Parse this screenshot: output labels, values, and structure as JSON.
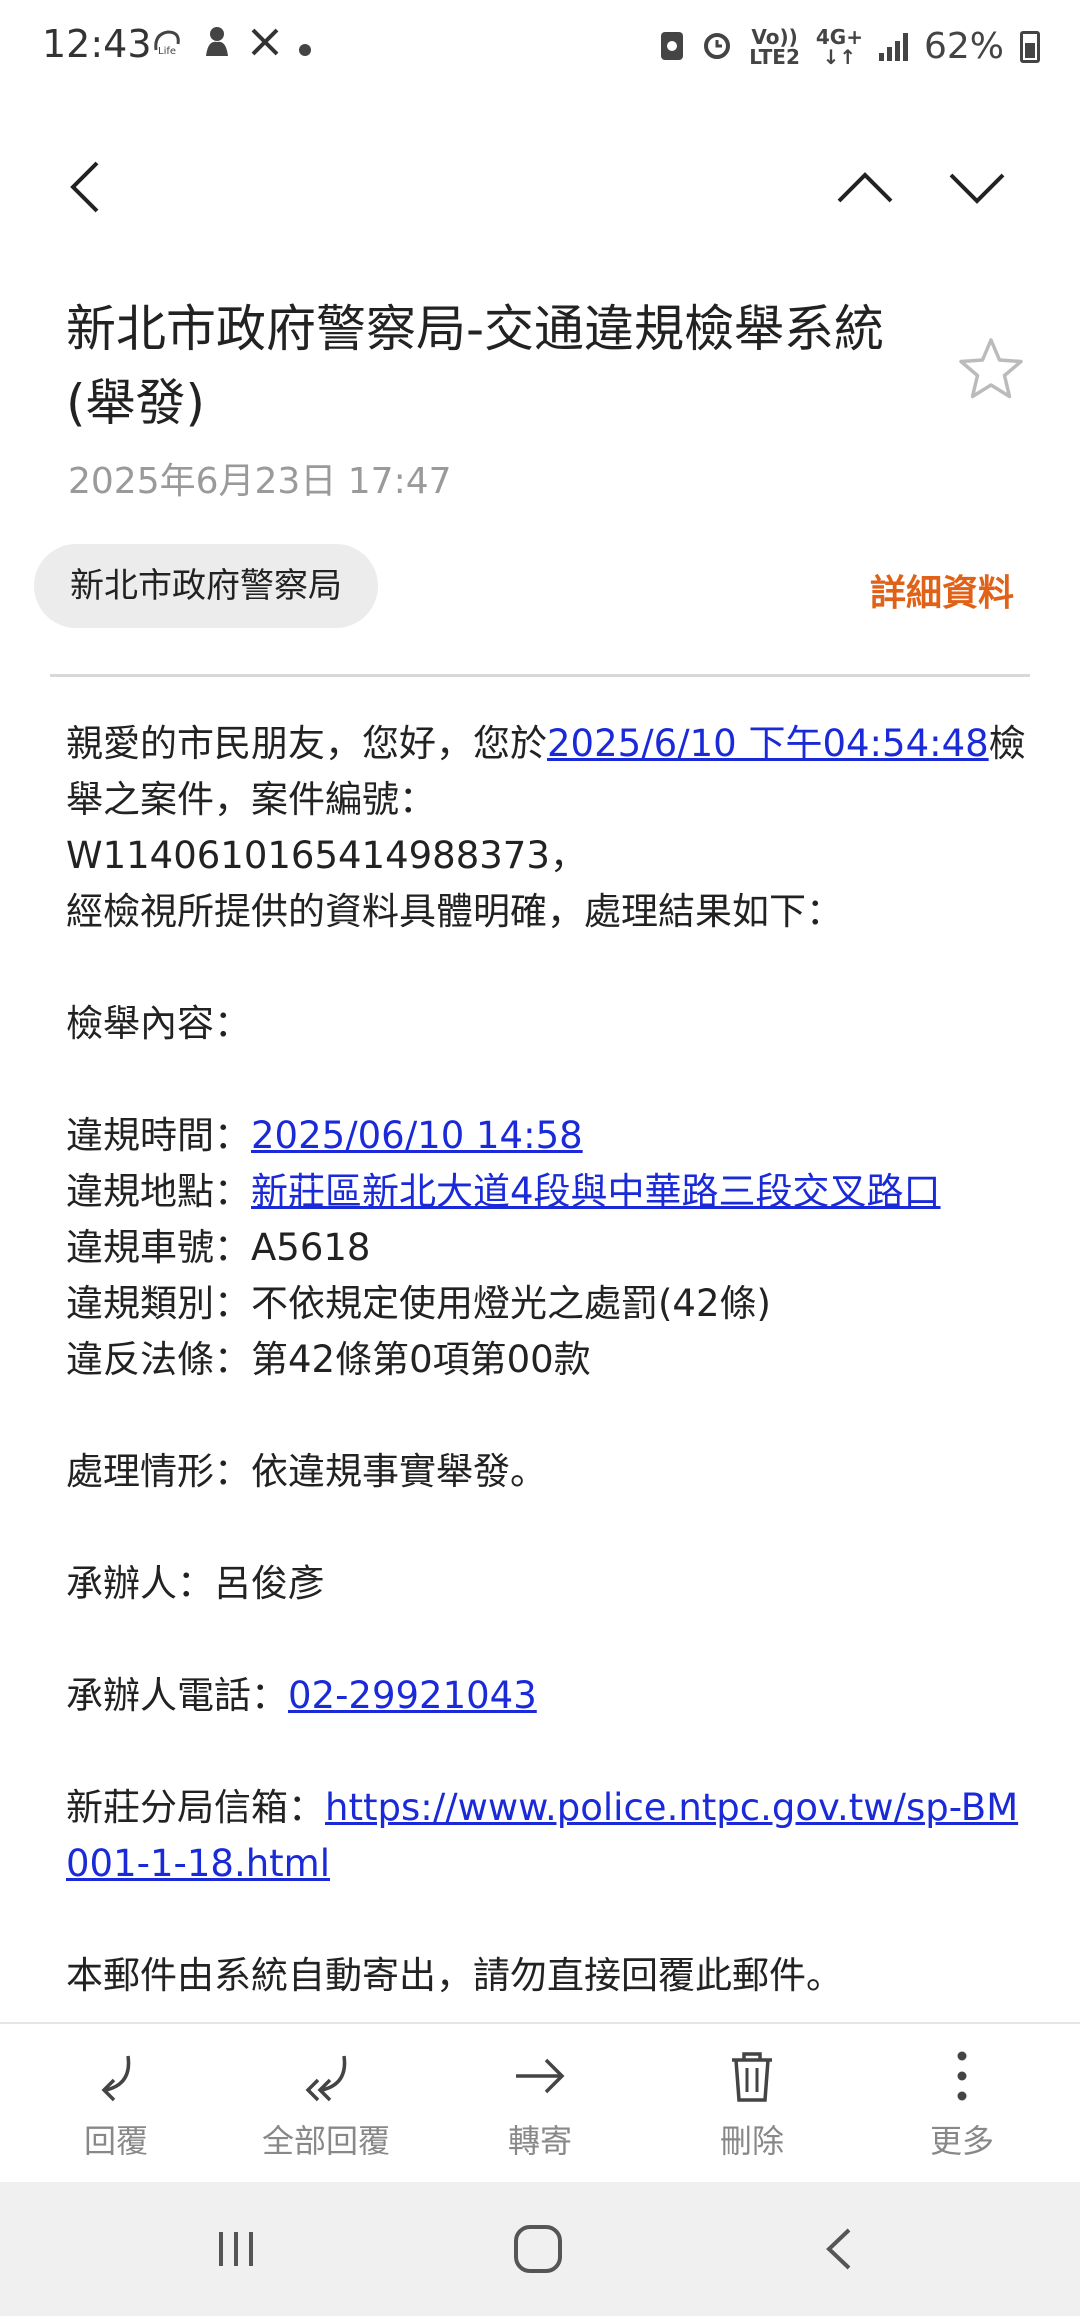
{
  "status_bar": {
    "time": "12:43",
    "left_icons": [
      "lte-app-icon",
      "notification-icon",
      "x-app-icon",
      "dot-icon"
    ],
    "network_top": "Vo))",
    "network_bottom": "LTE2",
    "network_type": "4G+",
    "battery": "62%"
  },
  "header": {
    "subject": "新北市政府警察局-交通違規檢舉系統(舉發)",
    "date": "2025年6月23日  17:47",
    "sender": "新北市政府警察局",
    "details_label": "詳細資料"
  },
  "body": {
    "intro_prefix": "親愛的市民朋友，您好，您於",
    "intro_link": "2025/6/10 下午04:54:48",
    "intro_suffix": "檢舉之案件，案件編號：",
    "case_number": "W1140610165414988373，",
    "review_line": "經檢視所提供的資料具體明確，處理結果如下：",
    "content_heading": "檢舉內容：",
    "violation_time_label": "違規時間：",
    "violation_time": "2025/06/10 14:58",
    "violation_place_label": "違規地點：",
    "violation_place": "新莊區新北大道4段與中華路三段交叉路口",
    "plate_label": "違規車號：",
    "plate": "A5618",
    "category_label": "違規類別：",
    "category": "不依規定使用燈光之處罰(42條)",
    "law_label": "違反法條：",
    "law": "第42條第0項第00款",
    "handling_label": "處理情形：",
    "handling": "依違規事實舉發。",
    "officer_label": "承辦人：",
    "officer": "呂俊彥",
    "phone_label": "承辦人電話：",
    "phone": "02-29921043",
    "mailbox_label": "新莊分局信箱：",
    "mailbox_url": "https://www.police.ntpc.gov.tw/sp-BM001-1-18.html",
    "footer_note": "本郵件由系統自動寄出，請勿直接回覆此郵件。"
  },
  "actions": [
    {
      "label": "回覆",
      "icon": "reply-icon"
    },
    {
      "label": "全部回覆",
      "icon": "reply-all-icon"
    },
    {
      "label": "轉寄",
      "icon": "forward-icon"
    },
    {
      "label": "刪除",
      "icon": "trash-icon"
    },
    {
      "label": "更多",
      "icon": "more-vertical-icon"
    }
  ],
  "colors": {
    "accent": "#e06218",
    "link": "#1a2ad8",
    "chip_bg": "#ececec"
  }
}
